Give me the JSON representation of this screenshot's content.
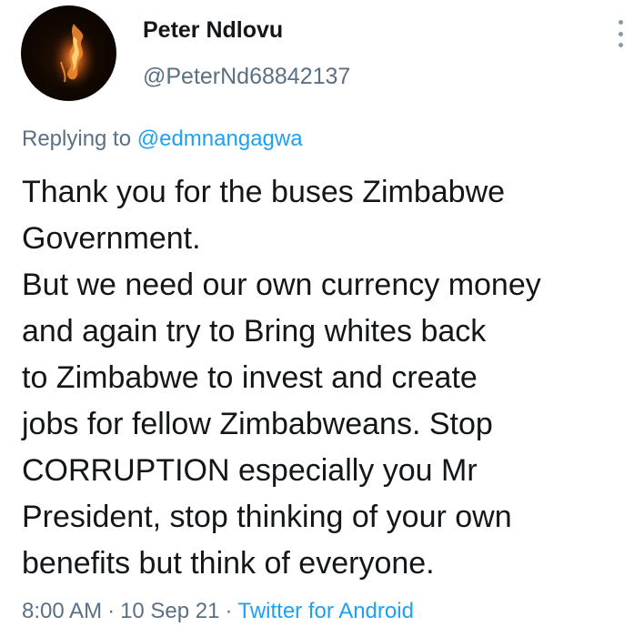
{
  "tweet": {
    "author": {
      "display_name": "Peter Ndlovu",
      "handle": "@PeterNd68842137",
      "avatar_icon": "flame-avatar"
    },
    "replying_prefix": "Replying to",
    "replying_to": "@edmnangagwa",
    "body_lines": [
      "Thank you for the buses Zimbabwe",
      "Government.",
      "But we need our own currency money",
      "and again try to Bring whites back",
      "to Zimbabwe to invest and create",
      "jobs for fellow Zimbabweans. Stop",
      "CORRUPTION especially you Mr",
      "President, stop thinking of your own",
      "benefits but think of everyone."
    ],
    "time": "8:00 AM",
    "date": "10 Sep 21",
    "separator": "·",
    "source": "Twitter for Android"
  },
  "colors": {
    "text_primary": "#14171a",
    "text_secondary": "#5b7083",
    "link": "#1da1f2",
    "background": "#ffffff"
  },
  "icons": {
    "more": "more-vertical-icon"
  }
}
